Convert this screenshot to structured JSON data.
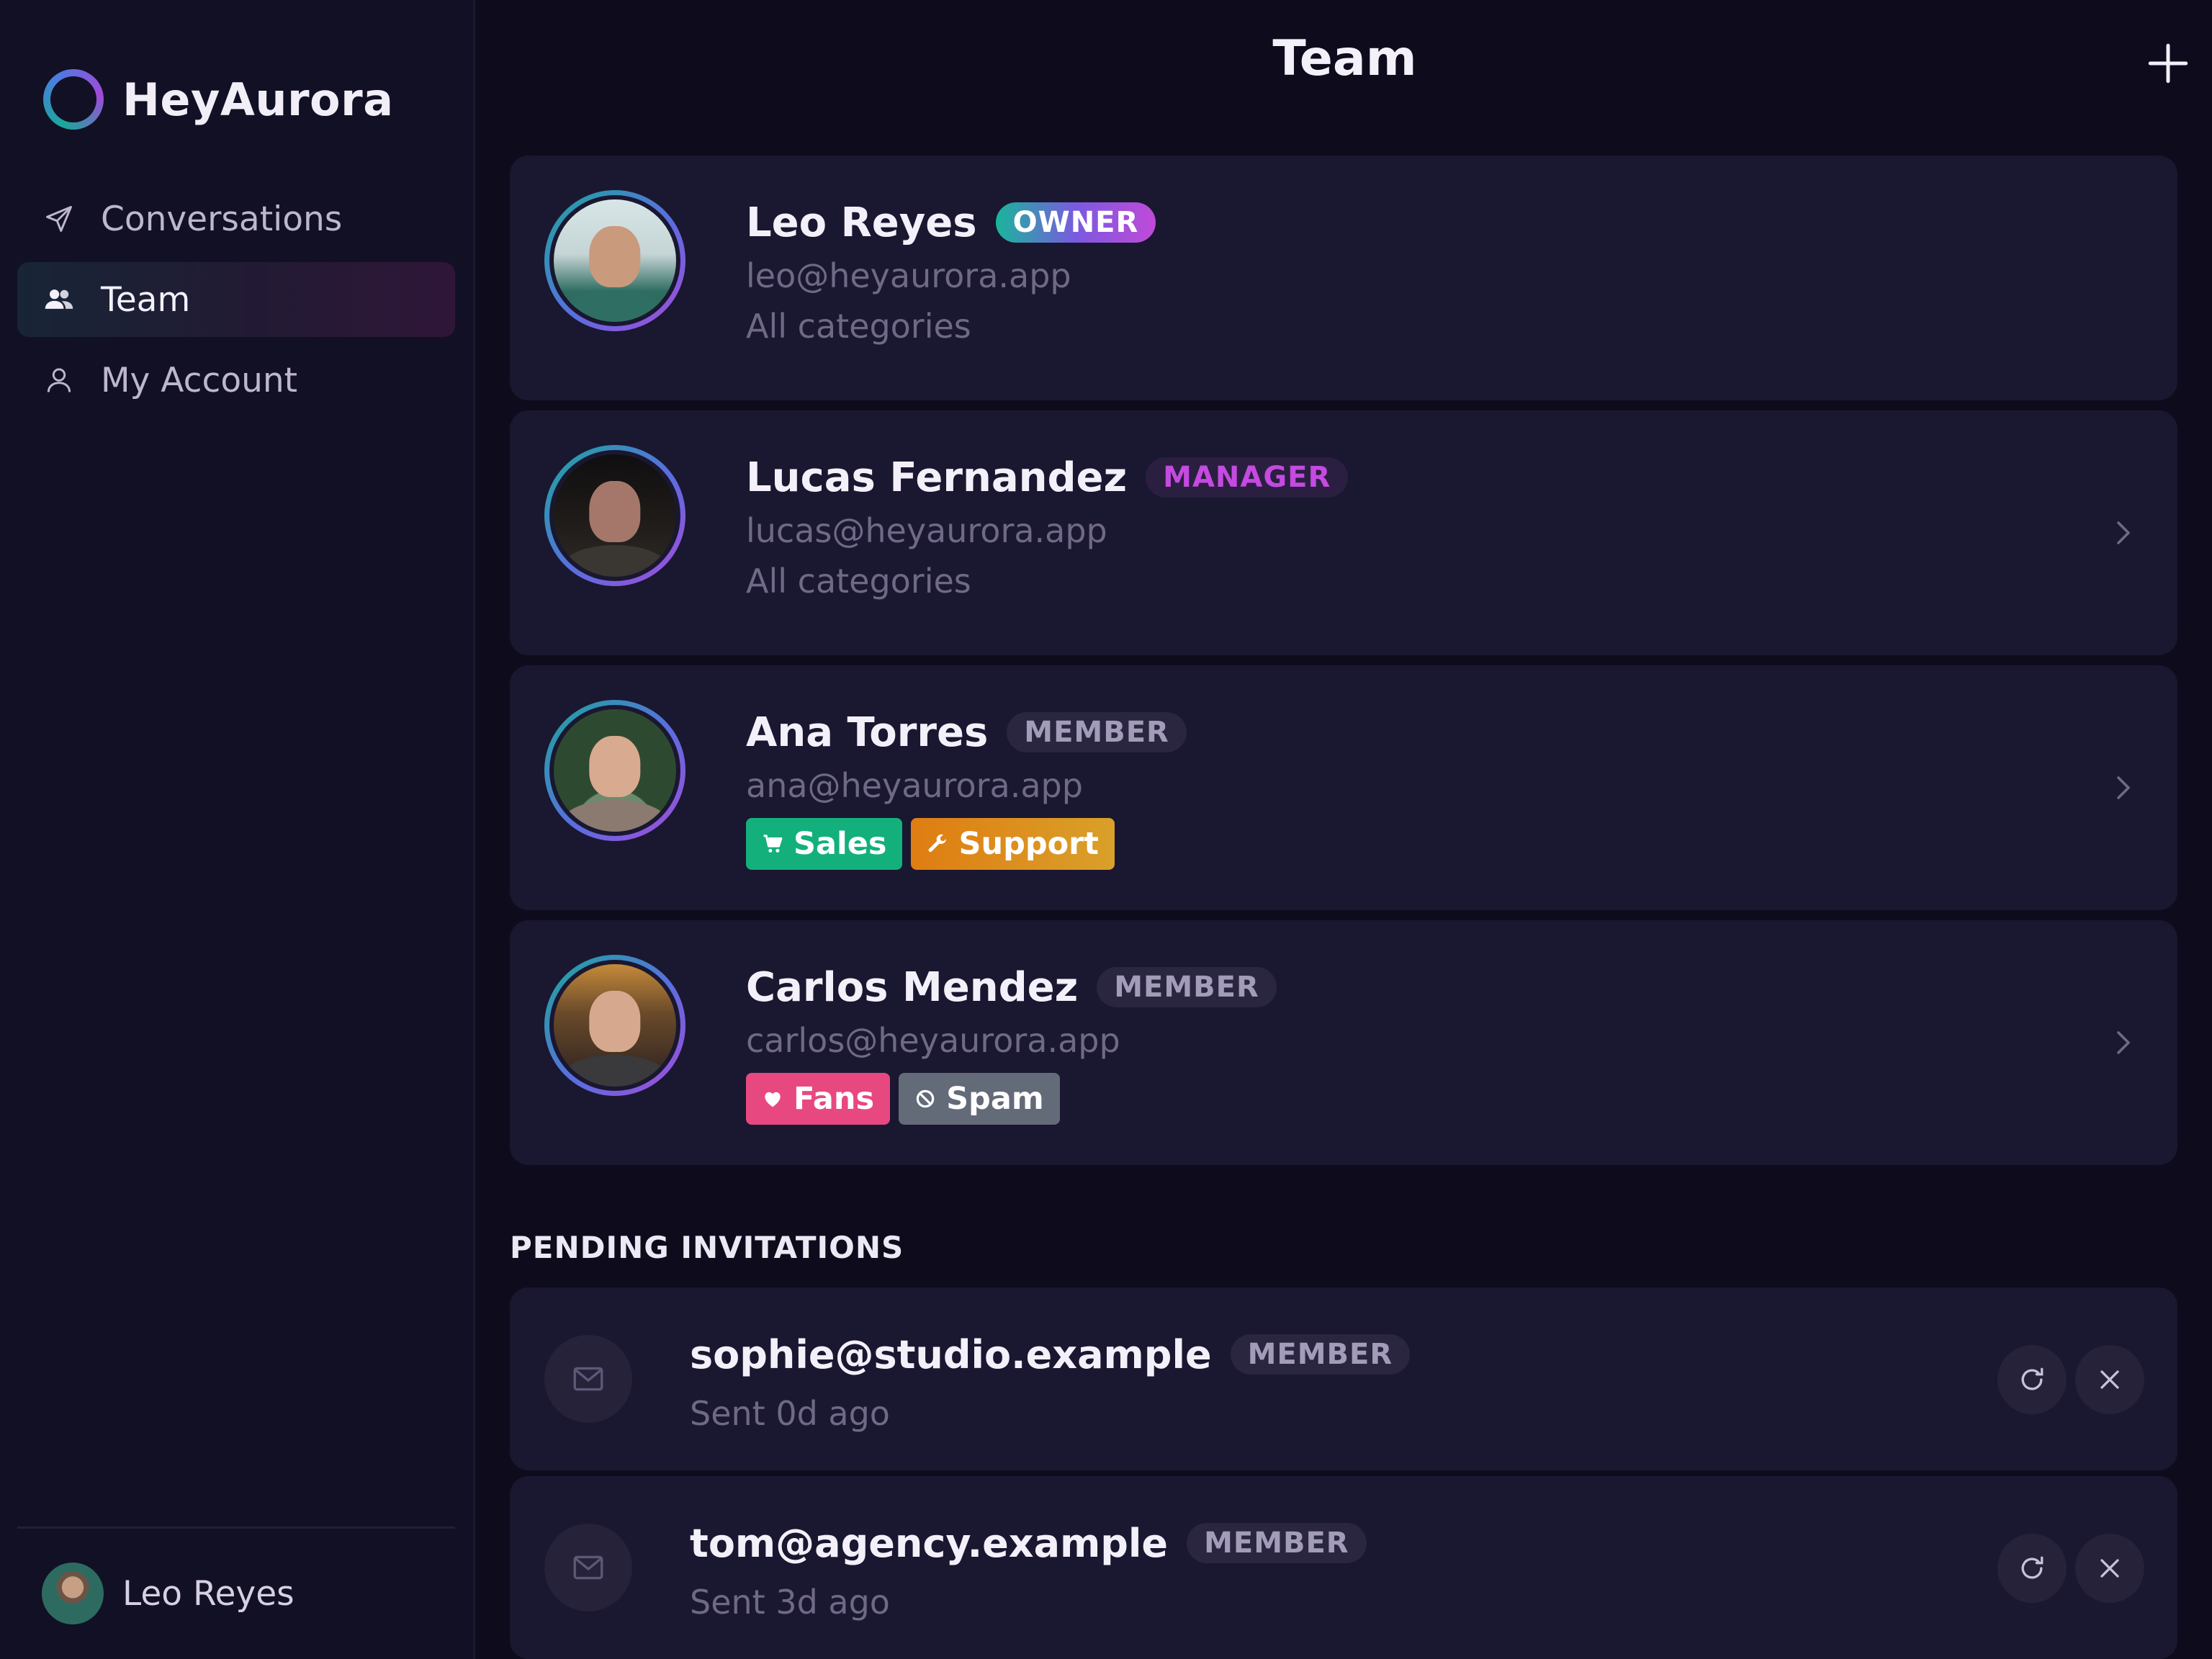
{
  "app": {
    "name": "HeyAurora"
  },
  "sidebar": {
    "items": [
      {
        "label": "Conversations",
        "icon": "send-icon",
        "active": false
      },
      {
        "label": "Team",
        "icon": "users-icon",
        "active": true
      },
      {
        "label": "My Account",
        "icon": "user-icon",
        "active": false
      }
    ],
    "current_user": "Leo Reyes"
  },
  "header": {
    "title": "Team",
    "add_icon": "plus-icon"
  },
  "members": [
    {
      "name": "Leo Reyes",
      "role": "OWNER",
      "email": "leo@heyaurora.app",
      "categories_text": "All categories",
      "tags": [],
      "has_chevron": false
    },
    {
      "name": "Lucas Fernandez",
      "role": "MANAGER",
      "email": "lucas@heyaurora.app",
      "categories_text": "All categories",
      "tags": [],
      "has_chevron": true
    },
    {
      "name": "Ana Torres",
      "role": "MEMBER",
      "email": "ana@heyaurora.app",
      "categories_text": "",
      "tags": [
        {
          "label": "Sales",
          "icon": "cart-icon",
          "color": "#13b07c"
        },
        {
          "label": "Support",
          "icon": "wrench-icon",
          "color": "#df7d12"
        }
      ],
      "has_chevron": true
    },
    {
      "name": "Carlos Mendez",
      "role": "MEMBER",
      "email": "carlos@heyaurora.app",
      "categories_text": "",
      "tags": [
        {
          "label": "Fans",
          "icon": "heart-icon",
          "color": "#e84880"
        },
        {
          "label": "Spam",
          "icon": "blocked-icon",
          "color": "#636a78"
        }
      ],
      "has_chevron": true
    }
  ],
  "pending": {
    "heading": "PENDING INVITATIONS",
    "invitations": [
      {
        "email": "sophie@studio.example",
        "role": "MEMBER",
        "sent": "Sent 0d ago"
      },
      {
        "email": "tom@agency.example",
        "role": "MEMBER",
        "sent": "Sent 3d ago"
      }
    ]
  },
  "colors": {
    "background": "#0e0c1c",
    "sidebar": "#121024",
    "card": "#1a1730",
    "owner_gradient": [
      "#1ab59a",
      "#c04ad8"
    ],
    "manager_text": "#c44ae0"
  }
}
